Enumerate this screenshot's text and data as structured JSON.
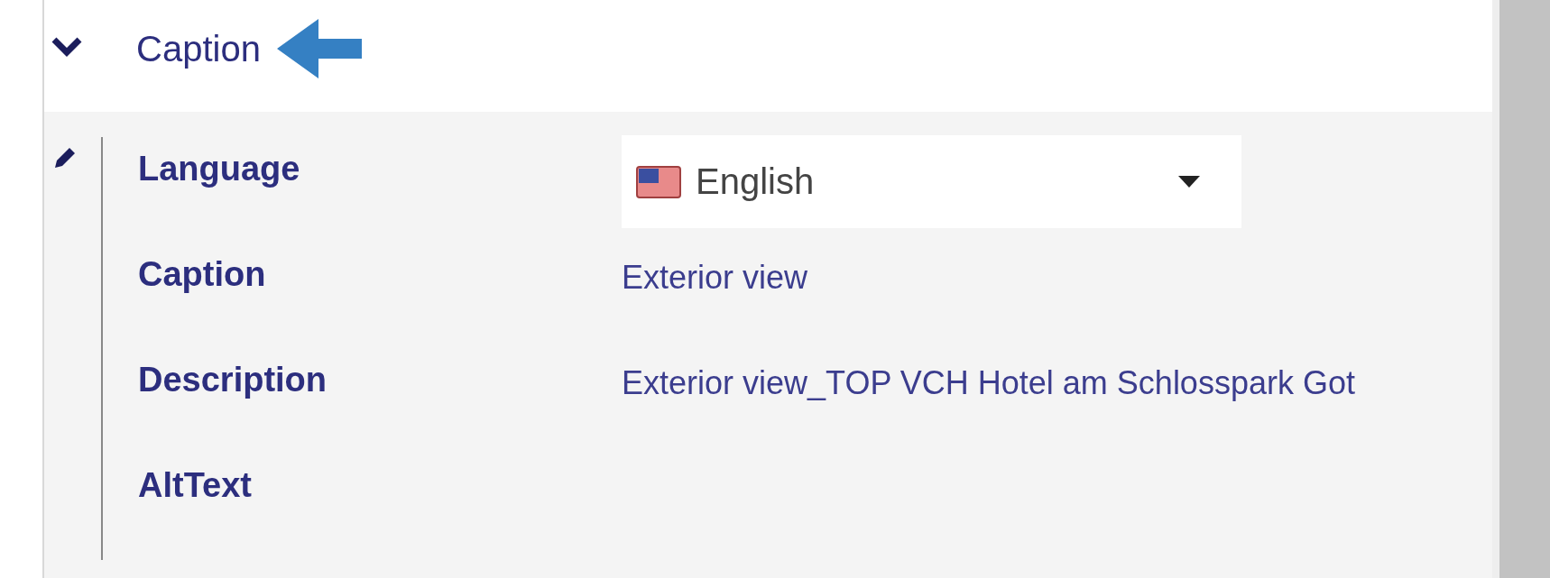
{
  "section": {
    "title": "Caption",
    "expanded": true
  },
  "fields": [
    {
      "label": "Language",
      "kind": "select",
      "value": "English"
    },
    {
      "label": "Caption",
      "kind": "text",
      "value": "Exterior view"
    },
    {
      "label": "Description",
      "kind": "text",
      "value": "Exterior view_TOP VCH Hotel am Schlosspark Got"
    },
    {
      "label": "AltText",
      "kind": "text"
    }
  ]
}
